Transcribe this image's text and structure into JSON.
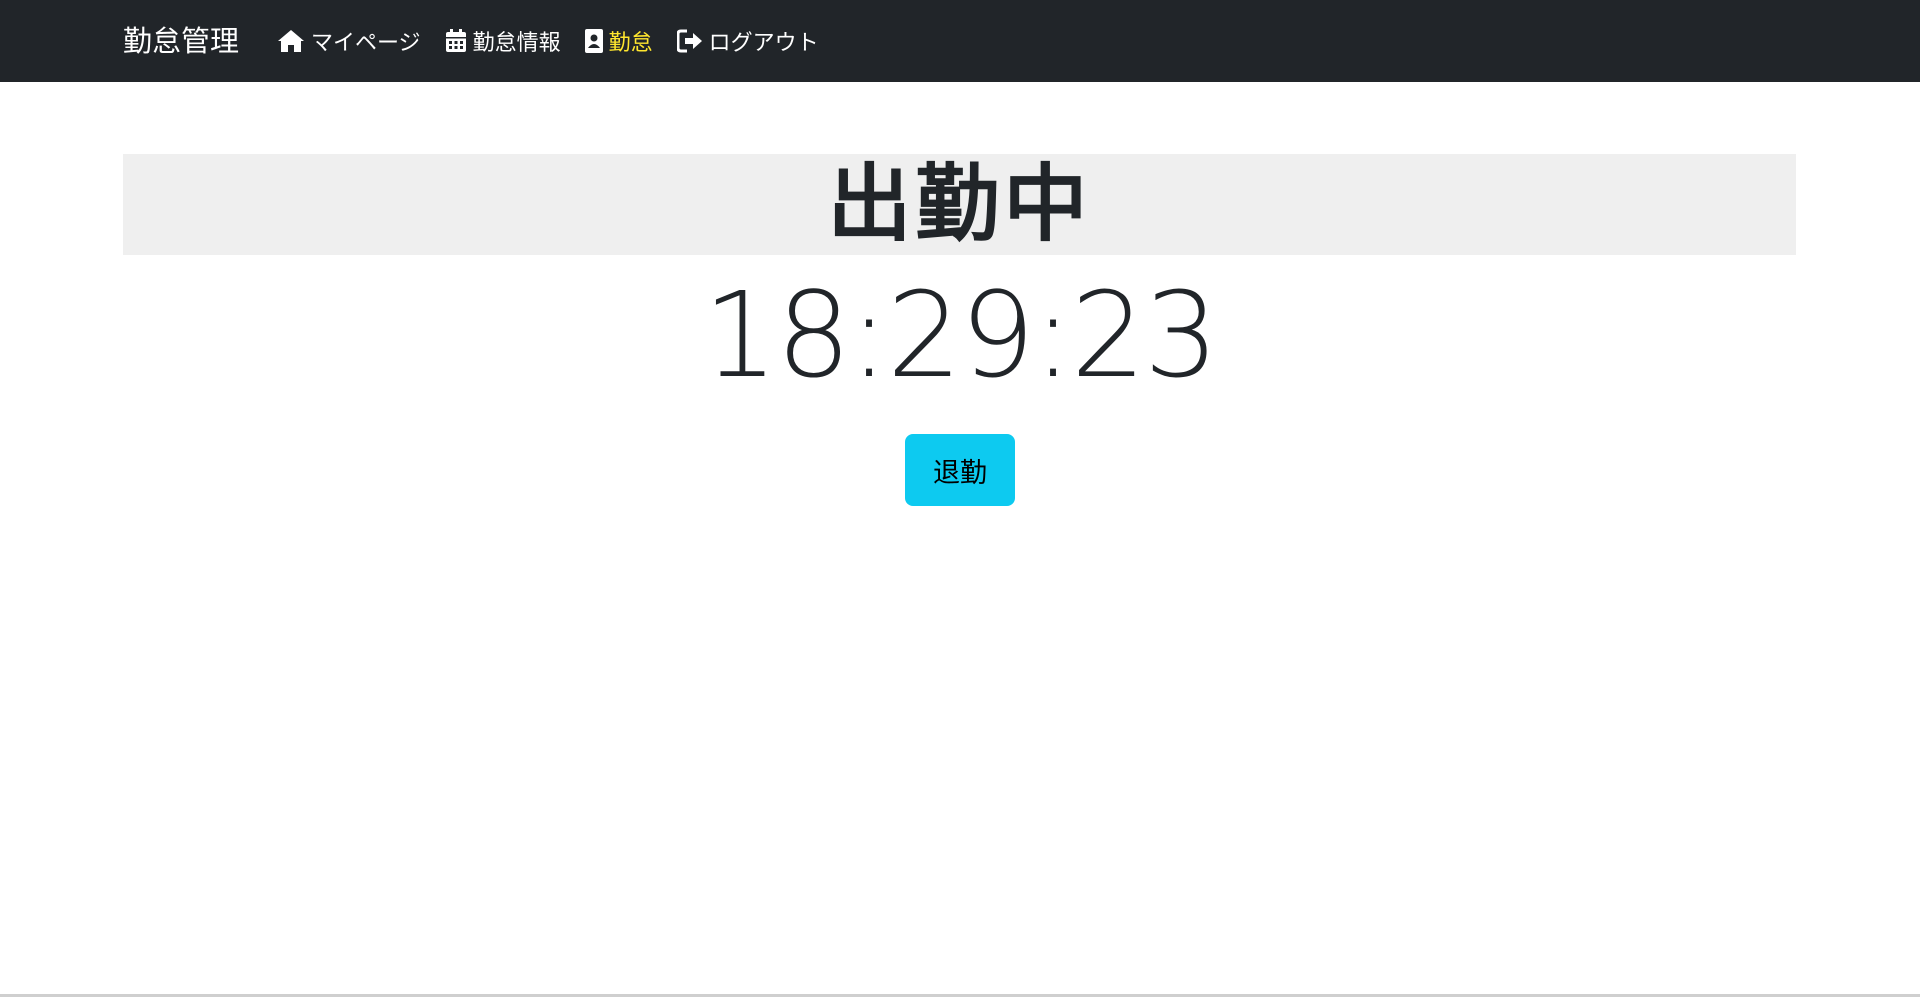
{
  "navbar": {
    "brand": "勤怠管理",
    "items": [
      {
        "label": "マイページ",
        "icon": "home-icon",
        "active": false
      },
      {
        "label": "勤怠情報",
        "icon": "calendar-icon",
        "active": false
      },
      {
        "label": "勤怠",
        "icon": "id-badge-icon",
        "active": true
      },
      {
        "label": "ログアウト",
        "icon": "sign-out-icon",
        "active": false
      }
    ],
    "colors": {
      "background": "#212529",
      "text": "#ffffff",
      "active_text": "#ffe62e"
    }
  },
  "main": {
    "status": "出勤中",
    "clock": "18:29:23",
    "clock_out_button": "退勤",
    "colors": {
      "banner_background": "#efefef",
      "button_background": "#0dcaf0"
    }
  }
}
